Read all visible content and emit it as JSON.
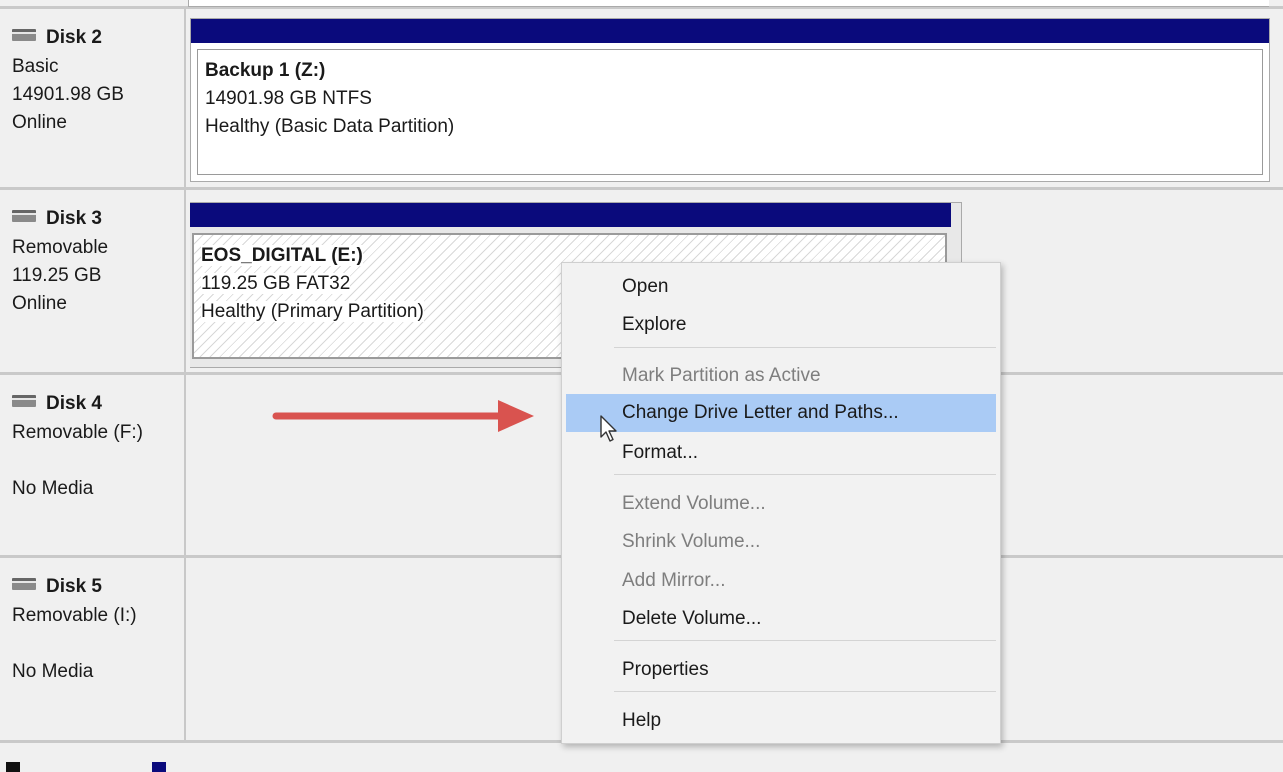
{
  "disks": [
    {
      "title": "Disk 2",
      "type": "Basic",
      "size": "14901.98 GB",
      "status": "Online"
    },
    {
      "title": "Disk 3",
      "type": "Removable",
      "size": "119.25 GB",
      "status": "Online"
    },
    {
      "title": "Disk 4",
      "type": "Removable (F:)",
      "size": "",
      "status": "No Media"
    },
    {
      "title": "Disk 5",
      "type": "Removable (I:)",
      "size": "",
      "status": "No Media"
    }
  ],
  "volumes": [
    {
      "name": "Backup 1  (Z:)",
      "detail": "14901.98 GB NTFS",
      "status": "Healthy (Basic Data Partition)"
    },
    {
      "name": "EOS_DIGITAL  (E:)",
      "detail": "119.25 GB FAT32",
      "status": "Healthy (Primary Partition)"
    }
  ],
  "menu": {
    "open": "Open",
    "explore": "Explore",
    "mark_active": "Mark Partition as Active",
    "change_letter": "Change Drive Letter and Paths...",
    "format": "Format...",
    "extend": "Extend Volume...",
    "shrink": "Shrink Volume...",
    "add_mirror": "Add Mirror...",
    "delete": "Delete Volume...",
    "properties": "Properties",
    "help": "Help"
  },
  "colors": {
    "partition_bar": "#0a0a7c",
    "highlight": "#aacbf5",
    "annotation_arrow": "#d9534f"
  },
  "icons": {
    "disk": "disk-icon",
    "cursor": "mouse-cursor-icon",
    "annotation": "red-arrow-annotation"
  }
}
